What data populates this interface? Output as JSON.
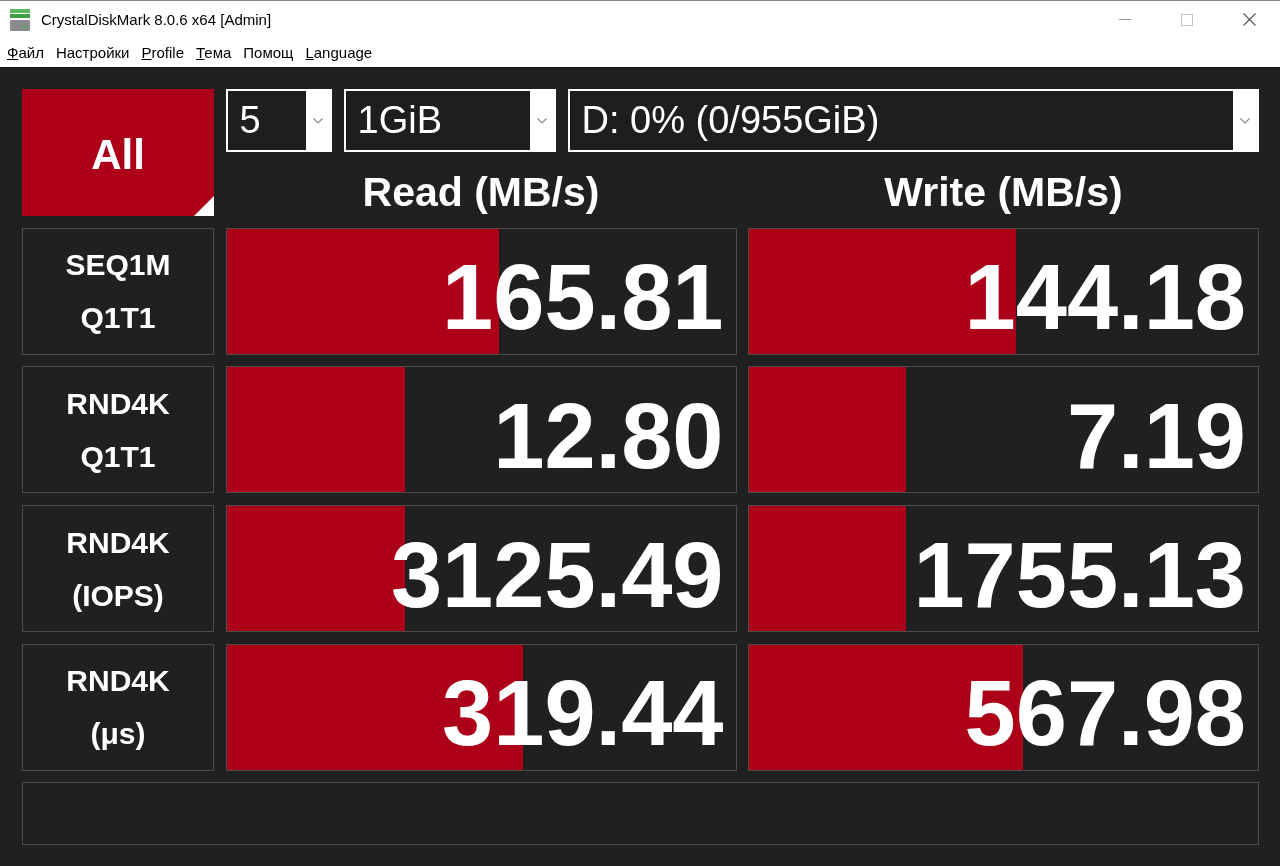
{
  "window": {
    "title": "CrystalDiskMark 8.0.6 x64 [Admin]"
  },
  "menu": [
    {
      "label": "Файл",
      "access_key_underlined": true
    },
    {
      "label": "Настройки",
      "access_key_underlined": false
    },
    {
      "label": "Profile",
      "access_key_underlined": true
    },
    {
      "label": "Тема",
      "access_key_underlined": true
    },
    {
      "label": "Помощ",
      "access_key_underlined": false
    },
    {
      "label": "Language",
      "access_key_underlined": true
    }
  ],
  "all_button": {
    "label": "All"
  },
  "selects": [
    {
      "kind": "count",
      "value": "5"
    },
    {
      "kind": "size",
      "value": "1GiB"
    },
    {
      "kind": "drive",
      "value": "D: 0% (0/955GiB)"
    }
  ],
  "columns": [
    "Read (MB/s)",
    "Write (MB/s)"
  ],
  "tests": [
    {
      "label": [
        "SEQ1M",
        "Q1T1"
      ],
      "results": [
        {
          "value": "165.81",
          "level": 0.535
        },
        {
          "value": "144.18",
          "level": 0.525
        }
      ]
    },
    {
      "label": [
        "RND4K",
        "Q1T1"
      ],
      "results": [
        {
          "value": "12.80",
          "level": 0.351
        },
        {
          "value": "7.19",
          "level": 0.308
        }
      ]
    },
    {
      "label": [
        "RND4K",
        "(IOPS)"
      ],
      "results": [
        {
          "value": "3125.49",
          "level": 0.351
        },
        {
          "value": "1755.13",
          "level": 0.308
        }
      ]
    },
    {
      "label": [
        "RND4K",
        "(μs)"
      ],
      "results": [
        {
          "value": "319.44",
          "level": 0.582
        },
        {
          "value": "567.98",
          "level": 0.539
        }
      ]
    }
  ]
}
